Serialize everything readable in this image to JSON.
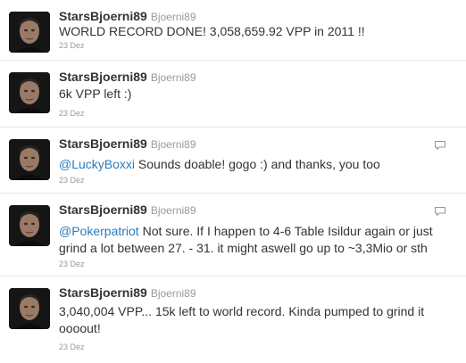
{
  "tweets": [
    {
      "fullname": "StarsBjoerni89",
      "screenname": "Bjoerni89",
      "mention": "",
      "text": "WORLD RECORD DONE! 3,058,659.92 VPP in 2011 !!",
      "date": "23 Dez",
      "has_reply_icon": false
    },
    {
      "fullname": "StarsBjoerni89",
      "screenname": "Bjoerni89",
      "mention": "",
      "text": "6k VPP left :)",
      "date": "23 Dez",
      "has_reply_icon": false
    },
    {
      "fullname": "StarsBjoerni89",
      "screenname": "Bjoerni89",
      "mention": "@LuckyBoxxi",
      "text": " Sounds doable! gogo :) and thanks, you too",
      "date": "23 Dez",
      "has_reply_icon": true
    },
    {
      "fullname": "StarsBjoerni89",
      "screenname": "Bjoerni89",
      "mention": "@Pokerpatriot",
      "text": " Not sure. If I happen to 4-6 Table Isildur again or just grind a lot between 27. - 31. it might aswell go up to ~3,3Mio or sth",
      "date": "23 Dez",
      "has_reply_icon": true
    },
    {
      "fullname": "StarsBjoerni89",
      "screenname": "Bjoerni89",
      "mention": "",
      "text": "3,040,004 VPP... 15k left to world record. Kinda pumped to grind it oooout!",
      "date": "23 Dez",
      "has_reply_icon": false
    }
  ],
  "colors": {
    "name": "#333333",
    "meta": "#999999",
    "mention": "#2b7bb9",
    "divider": "#e8e8e8"
  },
  "icons": {
    "avatar": "avatar",
    "reply": "reply-icon"
  }
}
